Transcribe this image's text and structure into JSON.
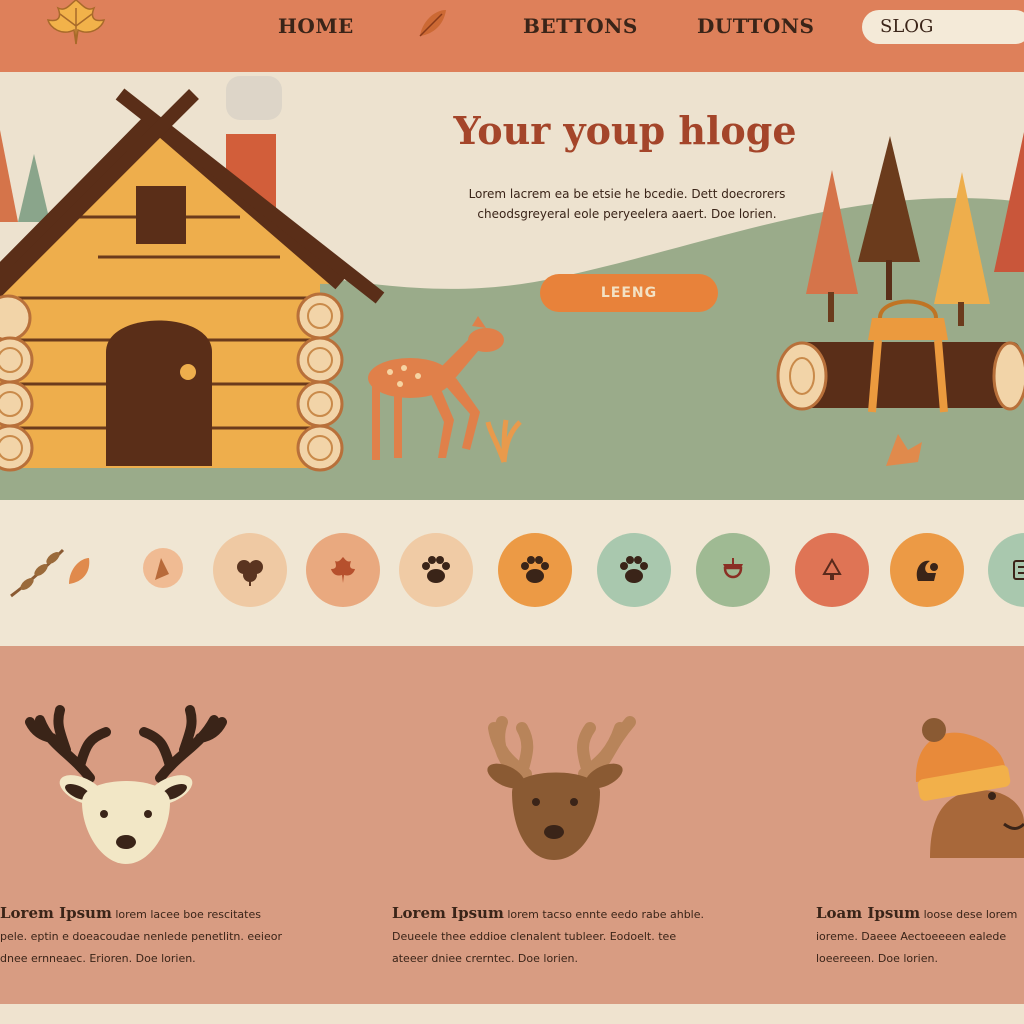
{
  "nav": {
    "links": [
      {
        "label": "HOME"
      },
      {
        "label": "BETTONS"
      },
      {
        "label": "DUTTONS"
      }
    ],
    "search_value": "SLOG"
  },
  "hero": {
    "title": "Your youp hloge",
    "body": "Lorem lacrem ea be etsie he bcedie. Dett doecrorers cheodsgreyeral eole peryeelera aaert. Doe lorien.",
    "cta_label": "LEENG"
  },
  "icons": [
    {
      "name": "branch-icon",
      "bg": "transparent",
      "fg": "#8a5a33"
    },
    {
      "name": "small-leaf-icon",
      "bg": "transparent",
      "fg": "#e08a4c"
    },
    {
      "name": "leaf-cluster-icon",
      "bg": "transparent",
      "fg": "#e8a070"
    },
    {
      "name": "clover-icon",
      "bg": "#efc9a3",
      "fg": "#5a3420"
    },
    {
      "name": "maple-leaf-icon",
      "bg": "#e9a97f",
      "fg": "#b6502d"
    },
    {
      "name": "paw-icon",
      "bg": "#f0cba5",
      "fg": "#3a2418"
    },
    {
      "name": "paw-icon",
      "bg": "#ec9a45",
      "fg": "#3a2418"
    },
    {
      "name": "paw-icon",
      "bg": "#a9c8ae",
      "fg": "#3a2418"
    },
    {
      "name": "acorn-icon",
      "bg": "#9fba93",
      "fg": "#8a2f24"
    },
    {
      "name": "tree-icon",
      "bg": "#df7455",
      "fg": "#5a2a1c"
    },
    {
      "name": "squirrel-icon",
      "bg": "#ec9a45",
      "fg": "#3a2418"
    },
    {
      "name": "card-icon",
      "bg": "#a9c8ae",
      "fg": "#3a2418"
    }
  ],
  "cards": [
    {
      "lead": "Lorem Ipsum",
      "body": "lorem lacee boe rescitates pele. eptin e doeacoudae nenlede penetlitn. eeieor dnee ernneaec. Erioren. Doe lorien."
    },
    {
      "lead": "Lorem Ipsum",
      "body": "lorem tacso ennte eedo rabe ahble. Deueele thee eddioe clenalent tubleer. Eodoelt. tee ateeer dniee crerntec. Doe lorien."
    },
    {
      "lead": "Loam Ipsum",
      "body": "loose dese lorem ioreme. Daeee Aectoeeeen ealede loeereeen. Doe lorien."
    }
  ]
}
